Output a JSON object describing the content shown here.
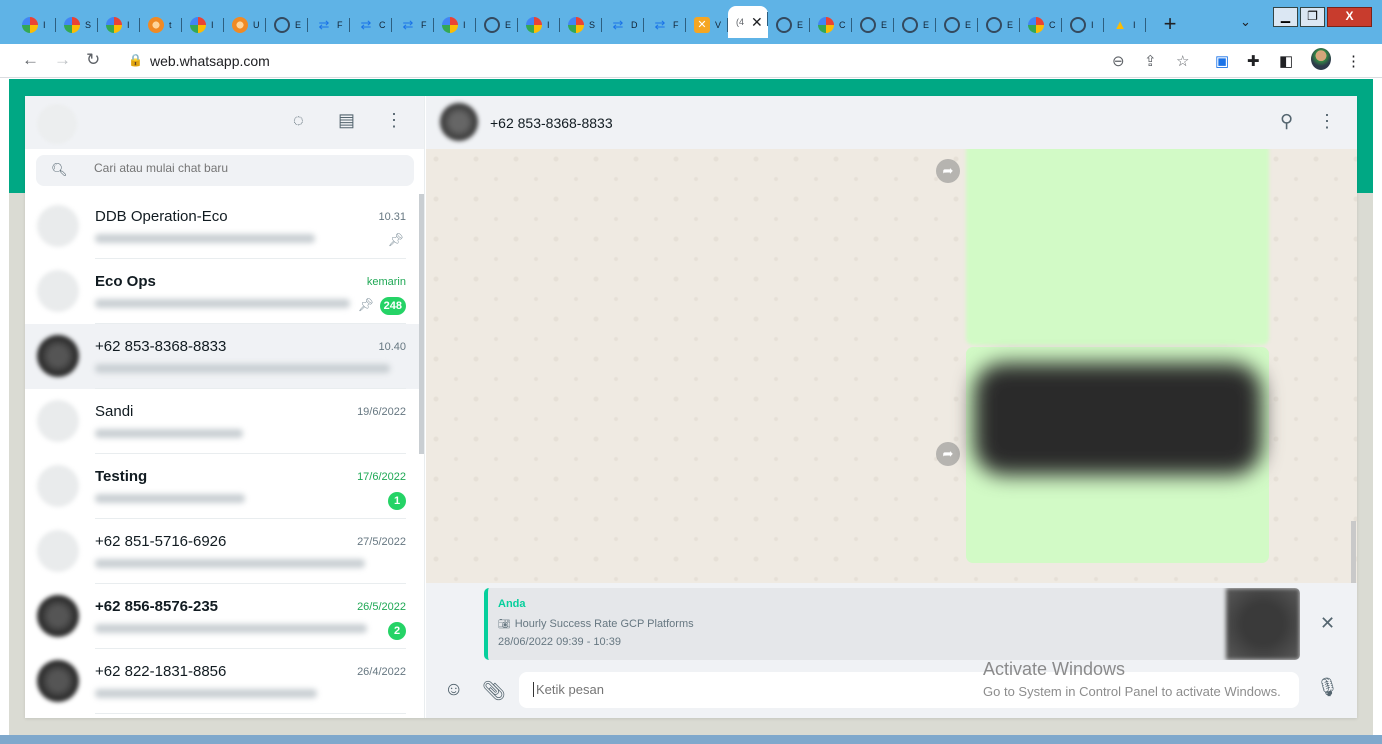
{
  "browser": {
    "tabs": [
      {
        "icon": "g",
        "short": "I"
      },
      {
        "icon": "g",
        "short": "S"
      },
      {
        "icon": "g",
        "short": "I"
      },
      {
        "icon": "o",
        "short": "t"
      },
      {
        "icon": "g",
        "short": "I"
      },
      {
        "icon": "o",
        "short": "U"
      },
      {
        "icon": "c",
        "short": "E"
      },
      {
        "icon": "b",
        "short": "F"
      },
      {
        "icon": "b",
        "short": "C"
      },
      {
        "icon": "b",
        "short": "F"
      },
      {
        "icon": "g",
        "short": "I"
      },
      {
        "icon": "c",
        "short": "E"
      },
      {
        "icon": "g",
        "short": "I"
      },
      {
        "icon": "g",
        "short": "S"
      },
      {
        "icon": "b",
        "short": "D"
      },
      {
        "icon": "b",
        "short": "F"
      },
      {
        "icon": "x",
        "short": "V"
      }
    ],
    "active_tab_short": "(4",
    "tabs_after": [
      {
        "icon": "c",
        "short": "E"
      },
      {
        "icon": "g",
        "short": "C"
      },
      {
        "icon": "c",
        "short": "E"
      },
      {
        "icon": "c",
        "short": "E"
      },
      {
        "icon": "c",
        "short": "E"
      },
      {
        "icon": "c",
        "short": "E"
      },
      {
        "icon": "g",
        "short": "C"
      },
      {
        "icon": "c",
        "short": "I"
      },
      {
        "icon": "d",
        "short": "I"
      }
    ],
    "url": "web.whatsapp.com"
  },
  "sidebar": {
    "search_placeholder": "Cari atau mulai chat baru",
    "chats": [
      {
        "name": "DDB Operation-Eco",
        "time": "10.31",
        "bold": false,
        "pinned": true,
        "badge": null,
        "time_green": false,
        "dark": false
      },
      {
        "name": "Eco Ops",
        "time": "kemarin",
        "bold": true,
        "pinned": true,
        "badge": "248",
        "time_green": true,
        "dark": false
      },
      {
        "name": "+62 853-8368-8833",
        "time": "10.40",
        "bold": false,
        "pinned": false,
        "badge": null,
        "time_green": false,
        "dark": true,
        "selected": true
      },
      {
        "name": "Sandi",
        "time": "19/6/2022",
        "bold": false,
        "pinned": false,
        "badge": null,
        "time_green": false,
        "dark": false
      },
      {
        "name": "Testing",
        "time": "17/6/2022",
        "bold": true,
        "pinned": false,
        "badge": "1",
        "time_green": true,
        "dark": false
      },
      {
        "name": "+62 851-5716-6926",
        "time": "27/5/2022",
        "bold": false,
        "pinned": false,
        "badge": null,
        "time_green": false,
        "dark": false
      },
      {
        "name": "+62 856-8576-235",
        "time": "26/5/2022",
        "bold": true,
        "pinned": false,
        "badge": "2",
        "time_green": true,
        "dark": true
      },
      {
        "name": "+62 822-1831-8856",
        "time": "26/4/2022",
        "bold": false,
        "pinned": false,
        "badge": null,
        "time_green": false,
        "dark": true
      }
    ]
  },
  "conversation": {
    "title": "+62 853-8368-8833",
    "reply": {
      "author": "Anda",
      "caption": "Hourly Success Rate GCP Platforms",
      "subtitle": "28/06/2022 09:39 - 10:39"
    },
    "input_placeholder": "Ketik pesan"
  },
  "overlay": {
    "title": "Activate Windows",
    "subtitle": "Go to System in Control Panel to activate Windows."
  },
  "colors": {
    "wa_green": "#00a884",
    "badge": "#25d366",
    "bubble": "#d2fac6"
  }
}
